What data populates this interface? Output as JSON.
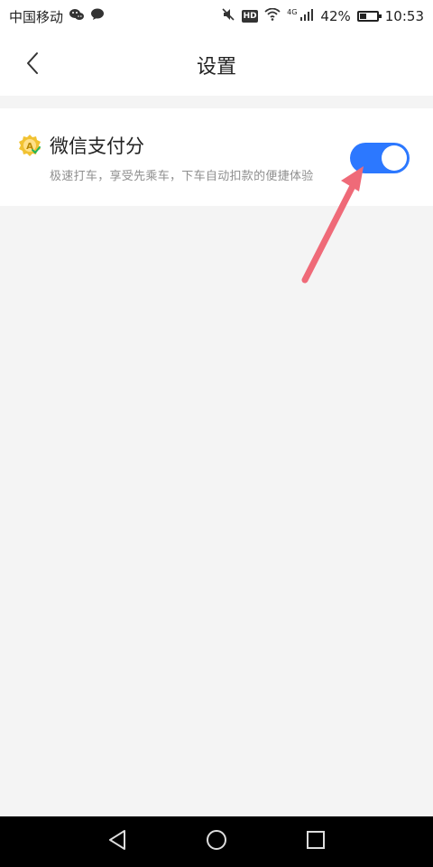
{
  "status": {
    "carrier": "中国移动",
    "network": "4G",
    "battery": "42%",
    "battery_fraction": 0.42,
    "hd": "HD",
    "time": "10:53"
  },
  "header": {
    "title": "设置"
  },
  "setting": {
    "title": "微信支付分",
    "description": "极速打车，享受先乘车，下车自动扣款的便捷体验",
    "toggle_on": true
  },
  "colors": {
    "toggle": "#2c78ff",
    "arrow": "#ef6a78",
    "background": "#f4f4f4"
  },
  "icons": {
    "back": "chevron-left-icon",
    "setting_badge": "wechat-pay-score-badge-icon",
    "nav_back": "triangle-back-icon",
    "nav_home": "circle-home-icon",
    "nav_recent": "square-recent-icon"
  }
}
